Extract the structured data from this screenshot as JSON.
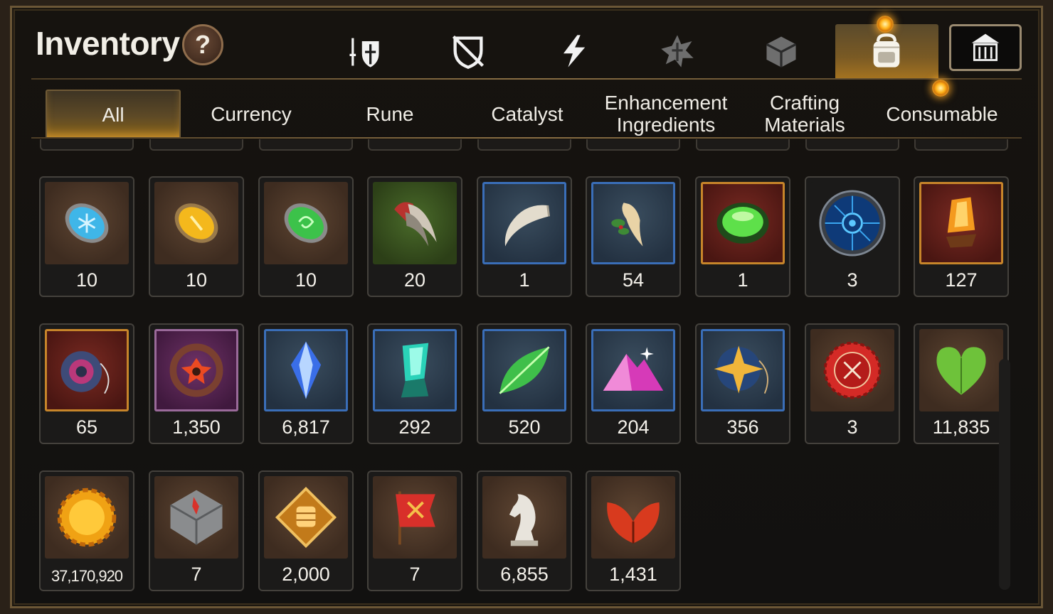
{
  "header": {
    "title": "Inventory",
    "help_label": "?"
  },
  "category_icons": [
    {
      "name": "equipment-icon",
      "active": false
    },
    {
      "name": "broken-shield-icon",
      "active": false
    },
    {
      "name": "lightning-icon",
      "active": false
    },
    {
      "name": "faded-rune-icon",
      "active": false
    },
    {
      "name": "cube-icon",
      "active": false
    },
    {
      "name": "backpack-icon",
      "active": true
    },
    {
      "name": "guild-hall-icon",
      "active": false
    }
  ],
  "tabs": [
    {
      "label": "All",
      "active": true
    },
    {
      "label": "Currency",
      "active": false
    },
    {
      "label": "Rune",
      "active": false
    },
    {
      "label": "Catalyst",
      "active": false
    },
    {
      "label": "Enhancement\nIngredients",
      "active": false
    },
    {
      "label": "Crafting\nMaterials",
      "active": false
    },
    {
      "label": "Consumable",
      "active": false,
      "notification": true
    }
  ],
  "items": [
    {
      "icon": "blue-snowflake-gem-icon",
      "quantity": "10"
    },
    {
      "icon": "yellow-gem-icon",
      "quantity": "10"
    },
    {
      "icon": "green-spiral-gem-icon",
      "quantity": "10"
    },
    {
      "icon": "claw-icon",
      "quantity": "20"
    },
    {
      "icon": "fang-icon",
      "quantity": "1"
    },
    {
      "icon": "ginseng-root-icon",
      "quantity": "54"
    },
    {
      "icon": "green-orb-icon",
      "quantity": "1"
    },
    {
      "icon": "blue-circuit-disc-icon",
      "quantity": "3"
    },
    {
      "icon": "orange-crystal-icon",
      "quantity": "127"
    },
    {
      "icon": "blue-ring-pendant-icon",
      "quantity": "65"
    },
    {
      "icon": "red-flower-ring-icon",
      "quantity": "1,350"
    },
    {
      "icon": "blue-crystal-icon",
      "quantity": "6,817"
    },
    {
      "icon": "teal-crystal-icon",
      "quantity": "292"
    },
    {
      "icon": "green-leaf-icon",
      "quantity": "520"
    },
    {
      "icon": "pink-mountain-icon",
      "quantity": "204"
    },
    {
      "icon": "star-pendant-icon",
      "quantity": "356"
    },
    {
      "icon": "red-badge-icon",
      "quantity": "3"
    },
    {
      "icon": "green-heart-icon",
      "quantity": "11,835"
    },
    {
      "icon": "gold-coin-icon",
      "quantity": "37,170,920"
    },
    {
      "icon": "stone-compass-icon",
      "quantity": "7"
    },
    {
      "icon": "fist-emblem-icon",
      "quantity": "2,000"
    },
    {
      "icon": "red-banner-icon",
      "quantity": "7"
    },
    {
      "icon": "chess-knight-icon",
      "quantity": "6,855"
    },
    {
      "icon": "red-leaf-icon",
      "quantity": "1,431"
    }
  ],
  "colors": {
    "frame_gold": "#6b5636",
    "active_glow": "#ffb21a",
    "text": "#f4f1ea"
  }
}
